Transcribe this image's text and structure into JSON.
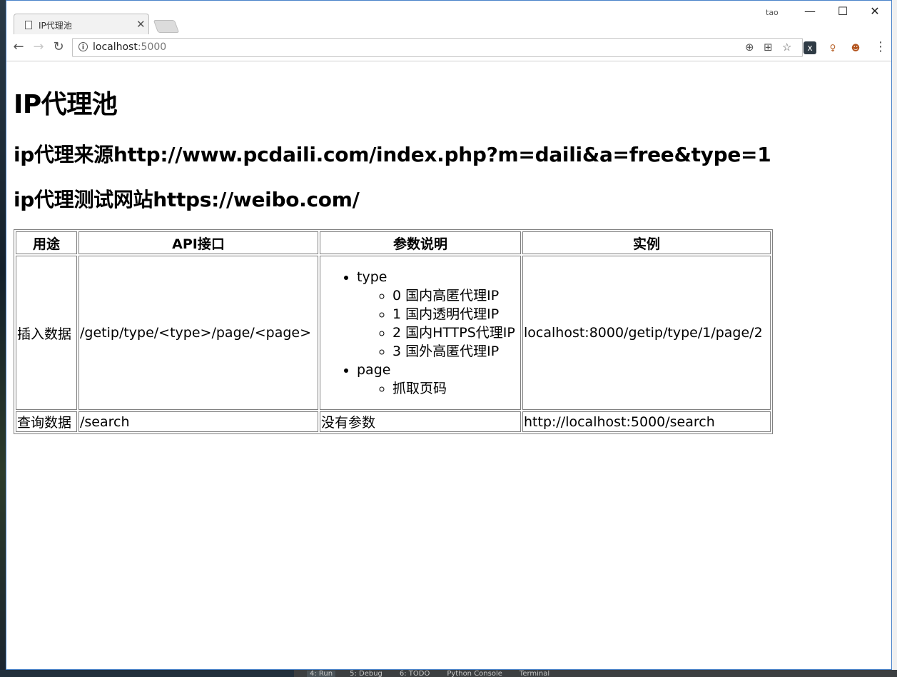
{
  "browser": {
    "tab_title": "IP代理池",
    "url_host": "localhost",
    "url_port": ":5000",
    "profile_name": "tao"
  },
  "page": {
    "heading": "IP代理池",
    "source_line": "ip代理来源http://www.pcdaili.com/index.php?m=daili&a=free&type=1",
    "test_line": "ip代理测试网站https://weibo.com/",
    "table": {
      "headers": [
        "用途",
        "API接口",
        "参数说明",
        "实例"
      ],
      "rows": [
        {
          "purpose": "插入数据",
          "api": "/getip/type/<type>/page/<page>",
          "params": [
            {
              "name": "type",
              "options": [
                "0 国内高匿代理IP",
                "1 国内透明代理IP",
                "2 国内HTTPS代理IP",
                "3 国外高匿代理IP"
              ]
            },
            {
              "name": "page",
              "options": [
                "抓取页码"
              ]
            }
          ],
          "example": "localhost:8000/getip/type/1/page/2"
        },
        {
          "purpose": "查询数据",
          "api": "/search",
          "params_text": "没有参数",
          "example": "http://localhost:5000/search"
        }
      ]
    }
  },
  "ide_toolbar": {
    "tabs": [
      "4: Run",
      "5: Debug",
      "6: TODO",
      "Python Console",
      "Terminal"
    ]
  },
  "icons": {
    "back": "arrow-left-icon",
    "forward": "arrow-right-icon",
    "reload": "reload-icon",
    "info": "info-icon",
    "zoom": "zoom-icon",
    "translate": "translate-icon",
    "bookmark": "star-icon",
    "menu": "kebab-menu-icon"
  }
}
